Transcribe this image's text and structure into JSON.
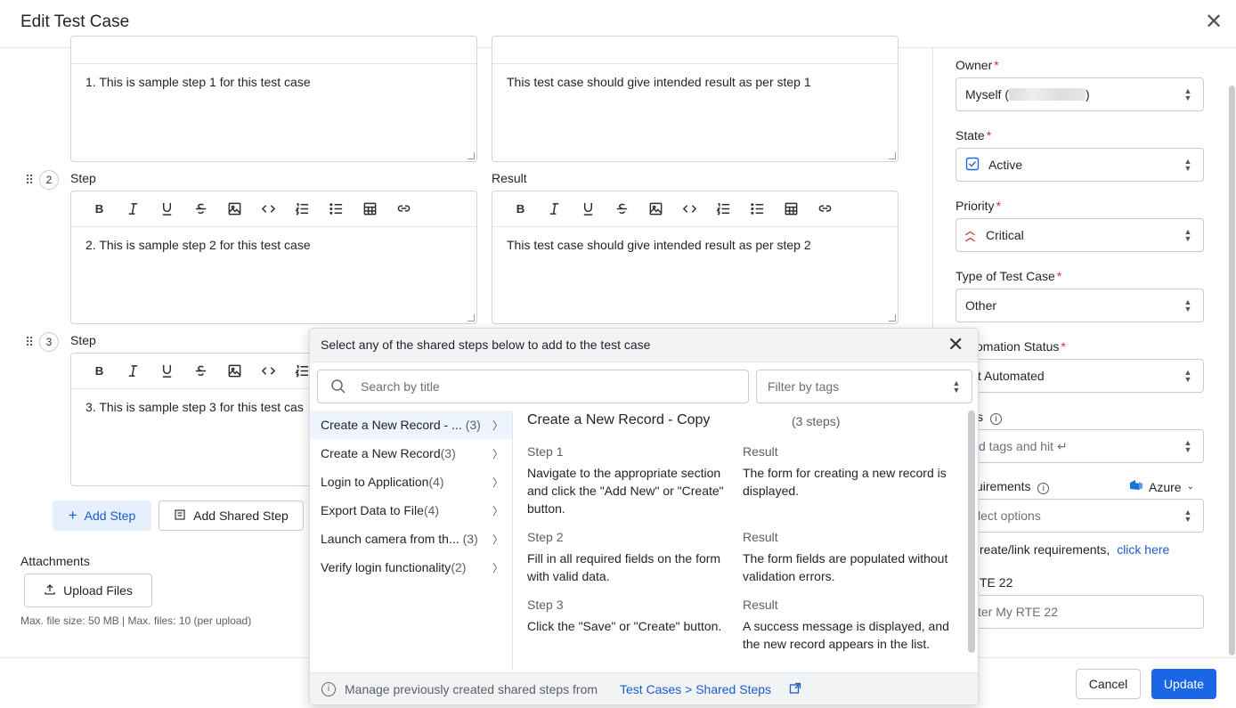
{
  "dialog": {
    "title": "Edit Test Case",
    "close": "✕"
  },
  "steps": [
    {
      "number": "",
      "step_label": "",
      "result_label": "",
      "step_text": "1. This is sample step 1 for this test case",
      "result_text": "This test case should give intended result as per step 1"
    },
    {
      "number": "2",
      "step_label": "Step",
      "result_label": "Result",
      "step_text": "2. This is sample step 2 for this test case",
      "result_text": "This test case should give intended result as per step 2"
    },
    {
      "number": "3",
      "step_label": "Step",
      "result_label": "",
      "step_text": "3. This is sample step 3 for this test cas",
      "result_text": ""
    }
  ],
  "toolbar_icons": [
    "bold-icon",
    "italic-icon",
    "underline-icon",
    "strikethrough-icon",
    "image-icon",
    "code-icon",
    "ordered-list-icon",
    "bullet-list-icon",
    "table-icon",
    "link-icon"
  ],
  "actions": {
    "add_step": "Add Step",
    "add_shared_step": "Add Shared Step"
  },
  "attachments": {
    "label": "Attachments",
    "upload": "Upload Files",
    "hint": "Max. file size: 50 MB | Max. files: 10 (per upload)"
  },
  "right": {
    "owner": {
      "label": "Owner",
      "value_prefix": "Myself (",
      "value_suffix": ")"
    },
    "state": {
      "label": "State",
      "value": "Active"
    },
    "priority": {
      "label": "Priority",
      "value": "Critical"
    },
    "type": {
      "label": "Type of Test Case",
      "value": "Other"
    },
    "automation": {
      "label": "omation Status",
      "value": "t Automated"
    },
    "tags": {
      "label": "s",
      "placeholder": "d tags and hit ↵"
    },
    "requirements": {
      "label": "uirements",
      "source": "Azure",
      "placeholder": "lect options"
    },
    "link_req": {
      "text": "reate/link requirements,",
      "link": "click here"
    },
    "rte": {
      "label": "TE 22",
      "placeholder": "ter My RTE 22"
    }
  },
  "footer": {
    "cancel": "Cancel",
    "update": "Update"
  },
  "popup": {
    "title": "Select any of the shared steps below to add to the test case",
    "search_placeholder": "Search by title",
    "filter_placeholder": "Filter by tags",
    "items": [
      {
        "name": "Create a New Record - ...",
        "count": "(3)"
      },
      {
        "name": "Create a New Record",
        "count": "(3)"
      },
      {
        "name": "Login to Application",
        "count": "(4)"
      },
      {
        "name": "Export Data to File",
        "count": "(4)"
      },
      {
        "name": "Launch camera from th...",
        "count": "(3)"
      },
      {
        "name": "Verify login functionality",
        "count": "(2)"
      }
    ],
    "detail": {
      "title": "Create a New Record - Copy",
      "count": "(3 steps)",
      "steps": [
        {
          "step": "Step 1",
          "result_label": "Result",
          "text": "Navigate to the appropriate section and click the \"Add New\" or \"Create\" button.",
          "result": "The form for creating a new record is displayed."
        },
        {
          "step": "Step 2",
          "result_label": "Result",
          "text": "Fill in all required fields on the form with valid data.",
          "result": "The form fields are populated without validation errors."
        },
        {
          "step": "Step 3",
          "result_label": "Result",
          "text": "Click the \"Save\" or \"Create\" button.",
          "result": "A success message is displayed, and the new record appears in the list."
        }
      ]
    },
    "footer_text": "Manage previously created shared steps from",
    "footer_link": "Test Cases > Shared Steps"
  }
}
